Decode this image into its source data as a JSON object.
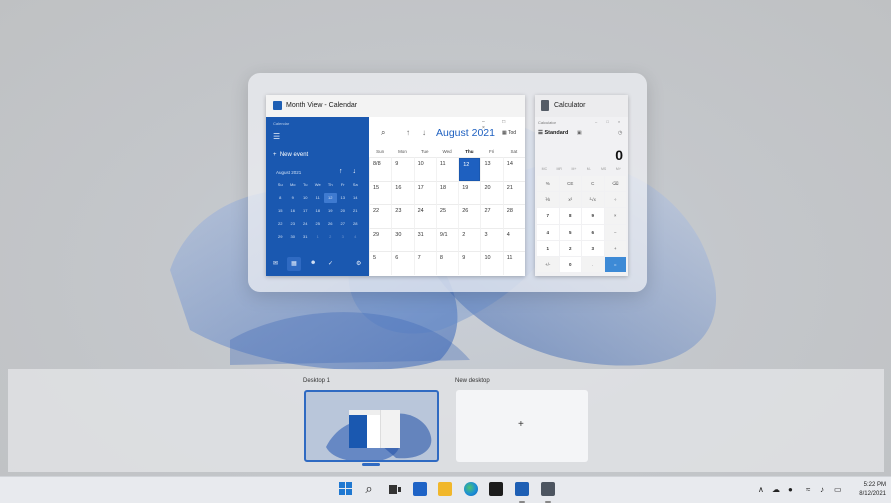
{
  "calendar": {
    "title": "Month View - Calendar",
    "sidebar_label": "Calendar",
    "menu_icon": "hamburger-icon",
    "new_event": "New event",
    "mini_month": "August 2021",
    "mini_nav": "↑ ↓",
    "mini_weekdays": [
      "Su",
      "Mo",
      "Tu",
      "We",
      "Th",
      "Fr",
      "Sa"
    ],
    "mini_days": [
      "8",
      "9",
      "10",
      "11",
      "12",
      "13",
      "14",
      "15",
      "16",
      "17",
      "18",
      "19",
      "20",
      "21",
      "22",
      "23",
      "24",
      "25",
      "26",
      "27",
      "28",
      "29",
      "30",
      "31",
      "1",
      "2",
      "3",
      "4"
    ],
    "search_icon": "⌕",
    "nav_up": "↑",
    "nav_down": "↓",
    "month_title": "August 2021",
    "today_label": "Tod",
    "window_controls": "– □ ×",
    "weekdays": [
      "Sun",
      "Mon",
      "Tue",
      "Wed",
      "Thu",
      "Fri",
      "Sat"
    ],
    "days": [
      "8/8",
      "9",
      "10",
      "11",
      "12",
      "13",
      "14",
      "15",
      "16",
      "17",
      "18",
      "19",
      "20",
      "21",
      "22",
      "23",
      "24",
      "25",
      "26",
      "27",
      "28",
      "29",
      "30",
      "31",
      "9/1",
      "2",
      "3",
      "4",
      "5",
      "6",
      "7",
      "8",
      "9",
      "10",
      "11"
    ],
    "selected_day": "12",
    "accent": "#1a58b0"
  },
  "calculator": {
    "title": "Calculator",
    "small_label": "Calculator",
    "window_controls": "– □ ×",
    "mode": "Standard",
    "display": "0",
    "memory_keys": [
      "MC",
      "MR",
      "M+",
      "M-",
      "MS",
      "M˅"
    ],
    "keys": [
      "%",
      "CE",
      "C",
      "⌫",
      "⅟x",
      "x²",
      "²√x",
      "÷",
      "7",
      "8",
      "9",
      "×",
      "4",
      "5",
      "6",
      "−",
      "1",
      "2",
      "3",
      "+",
      "+/-",
      "0",
      ".",
      "="
    ]
  },
  "desktops": [
    {
      "label": "Desktop 1"
    },
    {
      "label": "New desktop",
      "add_symbol": "+"
    }
  ],
  "taskbar": {
    "search_glyph": "⌕",
    "tray": "∧",
    "clock_time": "5:22 PM",
    "clock_date": "8/12/2021"
  }
}
